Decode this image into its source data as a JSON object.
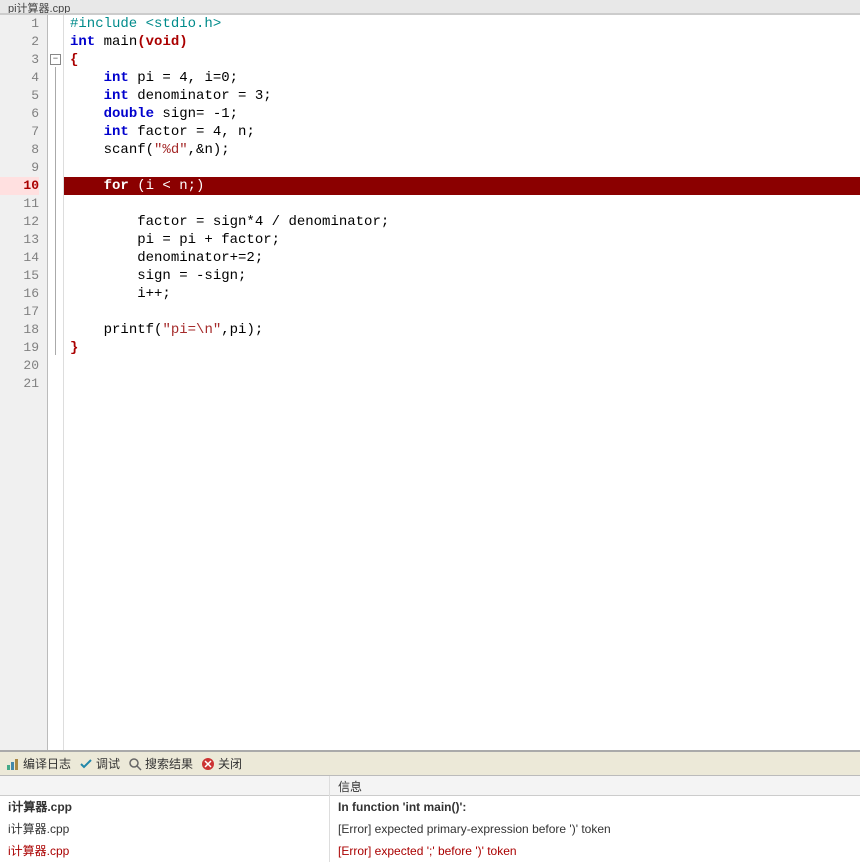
{
  "tab_title": "pi计算器.cpp",
  "gutter": [
    "1",
    "2",
    "3",
    "4",
    "5",
    "6",
    "7",
    "8",
    "9",
    "10",
    "11",
    "12",
    "13",
    "14",
    "15",
    "16",
    "17",
    "18",
    "19",
    "20",
    "21"
  ],
  "error_gutter_line": 10,
  "code": {
    "l1": {
      "pre": "#include",
      "inc": " <stdio.h>"
    },
    "l2": {
      "t1": "int",
      "t2": " main",
      "p": "(void)"
    },
    "l3": {
      "brace": "{"
    },
    "l4": {
      "type": "int",
      "rest": " pi = 4, i=0;"
    },
    "l5": {
      "type": "int",
      "rest": " denominator = 3;"
    },
    "l6": {
      "type": "double",
      "rest": " sign= -1;"
    },
    "l7": {
      "type": "int",
      "rest": " factor = 4, n;"
    },
    "l8": {
      "fn": "scanf",
      "str": "\"%d\"",
      "rest": ",&n);"
    },
    "l10": {
      "kw": "for",
      "rest": " (i < n;)"
    },
    "l12": {
      "txt": "factor = sign*4 / denominator;"
    },
    "l13": {
      "txt": "pi = pi + factor;"
    },
    "l14": {
      "txt": "denominator+=2;"
    },
    "l15": {
      "txt": "sign = -sign;"
    },
    "l16": {
      "txt": "i++;"
    },
    "l18": {
      "fn": "printf",
      "str": "\"pi=\\n\"",
      "rest": ",pi);"
    },
    "l19": {
      "brace": "}"
    }
  },
  "bottom_tabs": {
    "t1": "编译日志",
    "t2": "调试",
    "t3": "搜索结果",
    "t4": "关闭"
  },
  "messages": {
    "header_msg": "信息",
    "rows": [
      {
        "file": "i计算器.cpp",
        "msg": "In function 'int main()':",
        "err": false,
        "bold": true
      },
      {
        "file": "i计算器.cpp",
        "msg": "[Error] expected primary-expression before ')' token",
        "err": true,
        "bold": false
      },
      {
        "file": "i计算器.cpp",
        "msg": "[Error] expected ';' before ')' token",
        "err": true,
        "bold": false
      }
    ]
  }
}
